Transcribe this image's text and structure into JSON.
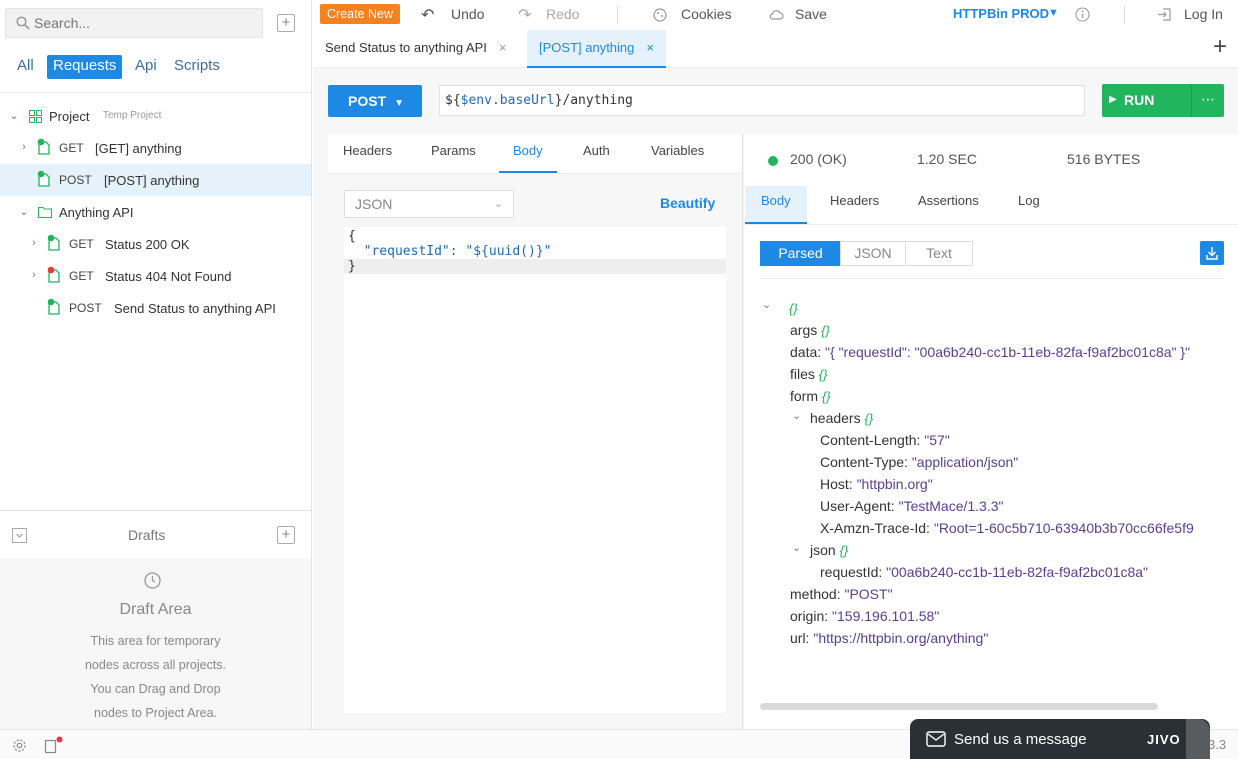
{
  "sidebar": {
    "search_placeholder": "Search...",
    "tabs": [
      "All",
      "Requests",
      "Api",
      "Scripts"
    ],
    "active_tab": "Requests",
    "tree": [
      {
        "type": "project",
        "label": "Project",
        "sub": "Temp Project"
      },
      {
        "type": "request",
        "method": "GET",
        "label": "[GET] anything",
        "status": "green"
      },
      {
        "type": "request",
        "method": "POST",
        "label": "[POST] anything",
        "status": "green",
        "selected": true
      },
      {
        "type": "folder",
        "label": "Anything API"
      },
      {
        "type": "request",
        "method": "GET",
        "label": "Status 200 OK",
        "status": "green"
      },
      {
        "type": "request",
        "method": "GET",
        "label": "Status 404 Not Found",
        "status": "red"
      },
      {
        "type": "request",
        "method": "POST",
        "label": "Send Status to anything API",
        "status": "green"
      }
    ],
    "drafts": {
      "title": "Drafts",
      "area_title": "Draft Area",
      "description": [
        "This area for temporary",
        "nodes across all projects.",
        "You can Drag and Drop",
        "nodes to Project Area."
      ]
    }
  },
  "toolbar": {
    "create_new": "Create New",
    "undo": "Undo",
    "redo": "Redo",
    "cookies": "Cookies",
    "save": "Save",
    "environment": "HTTPBin PROD",
    "login": "Log In"
  },
  "tabs": [
    {
      "label": "Send Status to anything API",
      "active": false
    },
    {
      "label": "[POST] anything",
      "active": true
    }
  ],
  "request": {
    "method": "POST",
    "url_prefix": "${",
    "url_var": "$env.baseUrl",
    "url_suffix": "}/anything",
    "run_label": "RUN",
    "subtabs": [
      "Headers",
      "Params",
      "Body",
      "Auth",
      "Variables"
    ],
    "active_subtab": "Body",
    "body_type": "JSON",
    "beautify": "Beautify",
    "body_lines": [
      "{",
      "  \"requestId\": \"${uuid()}\"",
      "}"
    ]
  },
  "response": {
    "status": "200 (OK)",
    "time": "1.20 SEC",
    "size": "516 BYTES",
    "tabs": [
      "Body",
      "Headers",
      "Assertions",
      "Log"
    ],
    "active_tab": "Body",
    "views": [
      "Parsed",
      "JSON",
      "Text"
    ],
    "active_view": "Parsed",
    "tree": {
      "root": "{}",
      "args": "args",
      "data_key": "data:",
      "data_val": "\"{ \"requestId\": \"00a6b240-cc1b-11eb-82fa-f9af2bc01c8a\" }\"",
      "files": "files",
      "form": "form",
      "headers": "headers",
      "content_length_key": "Content-Length:",
      "content_length_val": "\"57\"",
      "content_type_key": "Content-Type:",
      "content_type_val": "\"application/json\"",
      "host_key": "Host:",
      "host_val": "\"httpbin.org\"",
      "user_agent_key": "User-Agent:",
      "user_agent_val": "\"TestMace/1.3.3\"",
      "trace_key": "X-Amzn-Trace-Id:",
      "trace_val": "\"Root=1-60c5b710-63940b3b70cc66fe5f9",
      "json": "json",
      "request_id_key": "requestId:",
      "request_id_val": "\"00a6b240-cc1b-11eb-82fa-f9af2bc01c8a\"",
      "method_key": "method:",
      "method_val": "\"POST\"",
      "origin_key": "origin:",
      "origin_val": "\"159.196.101.58\"",
      "url_key": "url:",
      "url_val": "\"https://httpbin.org/anything\"",
      "empty_obj": "{}"
    }
  },
  "chat_widget": {
    "label": "Send us a message",
    "brand": "JIVO"
  },
  "version_fragment": "3.3"
}
